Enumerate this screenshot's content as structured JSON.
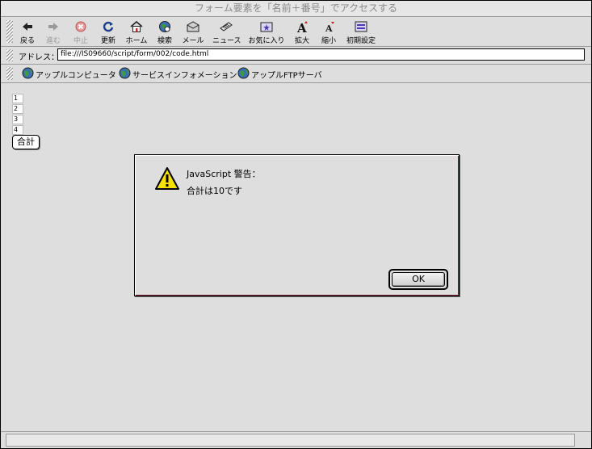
{
  "window": {
    "title": "フォーム要素を「名前＋番号」でアクセスする"
  },
  "toolbar": {
    "back": "戻る",
    "forward": "進む",
    "stop": "中止",
    "reload": "更新",
    "home": "ホーム",
    "search": "検索",
    "mail": "メール",
    "news": "ニュース",
    "favorites": "お気に入り",
    "larger": "拡大",
    "smaller": "縮小",
    "preferences": "初期設定"
  },
  "address": {
    "label": "アドレス：",
    "value": "file:///IS09660/script/form/002/code.html"
  },
  "favorites": [
    {
      "label": "アップルコンピュータ"
    },
    {
      "label": "サービスインフォメーション"
    },
    {
      "label": "アップルFTPサーバ"
    }
  ],
  "form": {
    "fields": [
      "1",
      "2",
      "3",
      "4"
    ],
    "sum_button": "合計"
  },
  "alert": {
    "title": "JavaScript 警告：",
    "message": "合計は10です",
    "ok": "OK"
  },
  "colors": {
    "background": "#dedede",
    "alert_border": "#8a1f3a",
    "warning_yellow": "#f5e000"
  }
}
